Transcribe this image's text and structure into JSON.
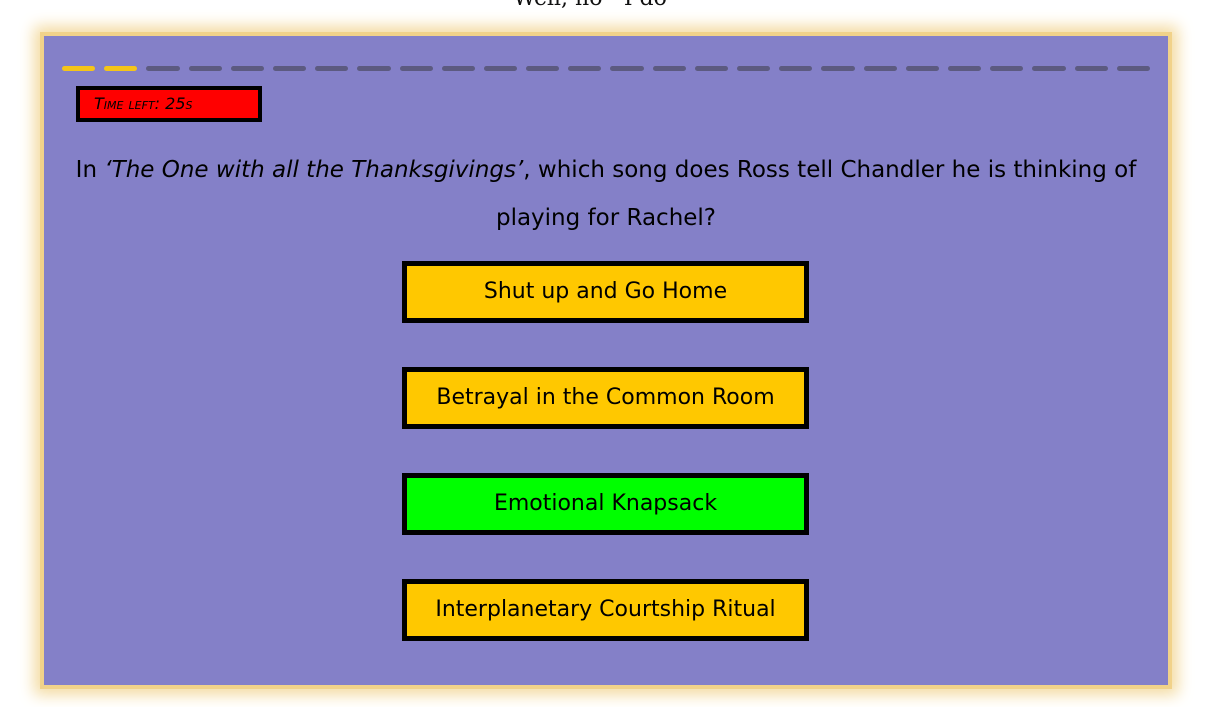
{
  "header": {
    "clipped_text": "Well, no - I do not…"
  },
  "progress": {
    "total_segments": 26,
    "completed_segments": 2,
    "completed_color": "#f5c518",
    "remaining_color": "#5c5a80"
  },
  "timer": {
    "label": "Time left: 25s"
  },
  "question": {
    "prefix": "In ",
    "episode": "‘The One with all the Thanksgivings’",
    "suffix": ", which song does Ross tell Chandler he is thinking of playing for Rachel?"
  },
  "answers": [
    {
      "label": "Shut up and Go Home",
      "state": "default"
    },
    {
      "label": "Betrayal in the Common Room",
      "state": "default"
    },
    {
      "label": "Emotional Knapsack",
      "state": "correct"
    },
    {
      "label": "Interplanetary Courtship Ritual",
      "state": "default"
    }
  ],
  "colors": {
    "panel": "#8480c8",
    "answer_default": "#ffc800",
    "answer_correct": "#00ff00",
    "timer_bg": "#ff0000",
    "frame_glow": "#f1d28a"
  }
}
